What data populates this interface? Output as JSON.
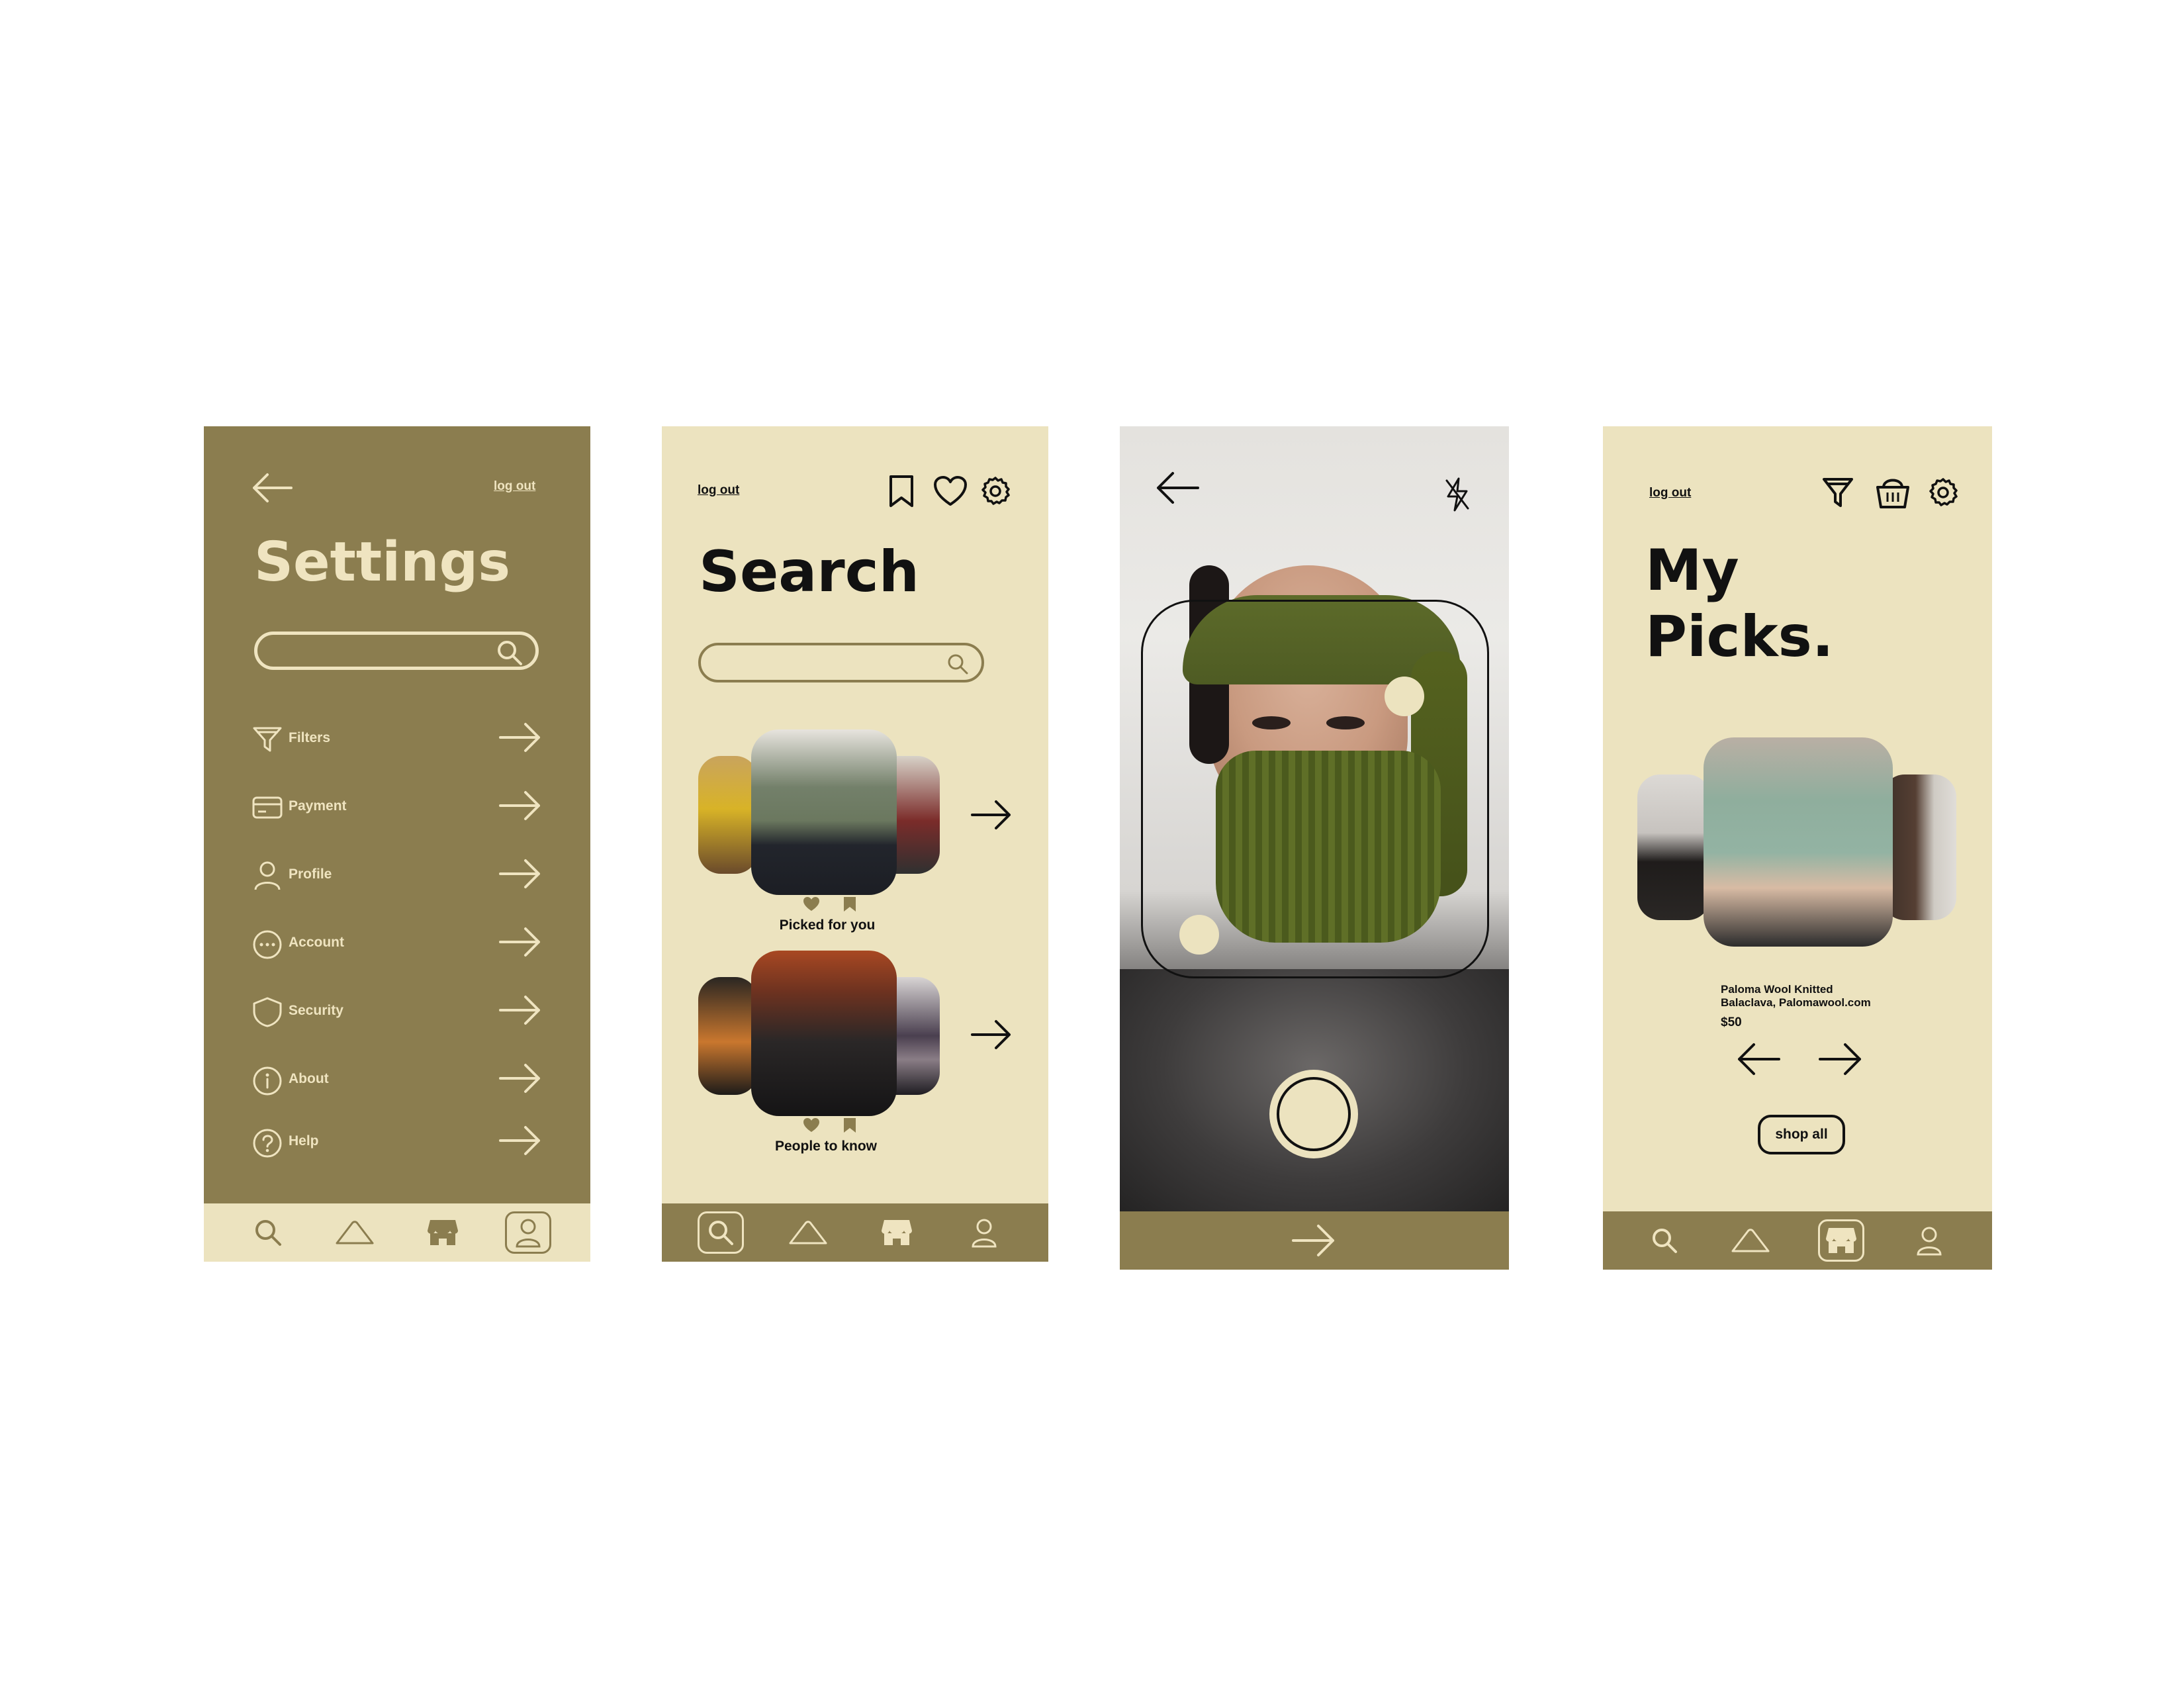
{
  "colors": {
    "olive": "#8b7d4f",
    "cream": "#ece3bf",
    "ink": "#111111",
    "white": "#ffffff"
  },
  "settings_screen": {
    "back_icon": "arrow-left-icon",
    "logout_label": "log out",
    "title": "Settings",
    "search": {
      "placeholder": "",
      "icon": "search-icon"
    },
    "menu": [
      {
        "label": "Filters",
        "icon": "filter-icon"
      },
      {
        "label": "Payment",
        "icon": "credit-card-icon"
      },
      {
        "label": "Profile",
        "icon": "user-icon"
      },
      {
        "label": "Account",
        "icon": "dots-circle-icon"
      },
      {
        "label": "Security",
        "icon": "shield-icon"
      },
      {
        "label": "About",
        "icon": "info-icon"
      },
      {
        "label": "Help",
        "icon": "help-icon"
      }
    ],
    "nav": {
      "active": "profile",
      "items": [
        "search-icon",
        "home-icon",
        "shop-icon",
        "user-icon"
      ]
    }
  },
  "search_screen": {
    "logout_label": "log out",
    "header_icons": [
      "bookmark-icon",
      "heart-icon",
      "gear-icon"
    ],
    "title": "Search",
    "search": {
      "placeholder": "",
      "icon": "search-icon"
    },
    "carousels": [
      {
        "caption": "Picked for you"
      },
      {
        "caption": "People to know"
      }
    ],
    "nav": {
      "active": "search",
      "items": [
        "search-icon",
        "home-icon",
        "shop-icon",
        "user-icon"
      ]
    }
  },
  "camera_screen": {
    "back_icon": "arrow-left-icon",
    "flash_icon": "flash-off-icon",
    "shutter_icon": "shutter-button",
    "next_icon": "arrow-right-icon"
  },
  "picks_screen": {
    "logout_label": "log out",
    "header_icons": [
      "filter-icon",
      "basket-icon",
      "gear-icon"
    ],
    "title_line1": "My",
    "title_line2": "Picks.",
    "product": {
      "name_line1": "Paloma Wool Knitted",
      "name_line2": "Balaclava, Palomawool.com",
      "price": "$50"
    },
    "shop_all_label": "shop all",
    "nav": {
      "active": "shop",
      "items": [
        "search-icon",
        "home-icon",
        "shop-icon",
        "user-icon"
      ]
    }
  }
}
